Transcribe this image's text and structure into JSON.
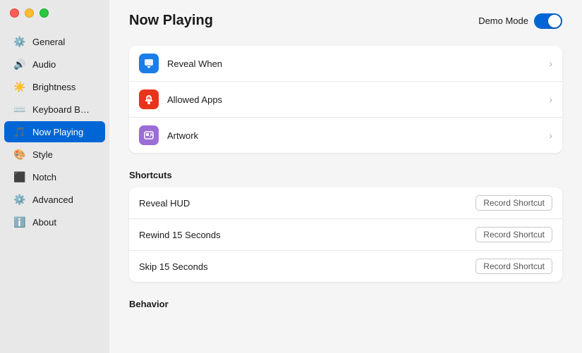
{
  "window": {
    "title": "Now Playing"
  },
  "windowControls": {
    "close": "close",
    "minimize": "minimize",
    "maximize": "maximize"
  },
  "sidebar": {
    "items": [
      {
        "id": "general",
        "label": "General",
        "icon": "⚙️"
      },
      {
        "id": "audio",
        "label": "Audio",
        "icon": "🔊"
      },
      {
        "id": "brightness",
        "label": "Brightness",
        "icon": "☀️"
      },
      {
        "id": "keyboard",
        "label": "Keyboard B…",
        "icon": "⌨️"
      },
      {
        "id": "now-playing",
        "label": "Now Playing",
        "icon": "🎵",
        "active": true
      },
      {
        "id": "style",
        "label": "Style",
        "icon": "🎨"
      },
      {
        "id": "notch",
        "label": "Notch",
        "icon": "⬛"
      },
      {
        "id": "advanced",
        "label": "Advanced",
        "icon": "⚙️"
      },
      {
        "id": "about",
        "label": "About",
        "icon": "ℹ️"
      }
    ]
  },
  "header": {
    "title": "Now Playing",
    "demoModeLabel": "Demo Mode",
    "demoModeOn": true
  },
  "menuRows": [
    {
      "id": "reveal-when",
      "label": "Reveal When",
      "iconBg": "icon-blue",
      "icon": "⬇️"
    },
    {
      "id": "allowed-apps",
      "label": "Allowed Apps",
      "iconBg": "icon-red",
      "icon": "✋"
    },
    {
      "id": "artwork",
      "label": "Artwork",
      "iconBg": "icon-purple",
      "icon": "🖼️"
    }
  ],
  "shortcuts": {
    "sectionTitle": "Shortcuts",
    "items": [
      {
        "id": "reveal-hud",
        "label": "Reveal HUD",
        "btnLabel": "Record Shortcut"
      },
      {
        "id": "rewind-15",
        "label": "Rewind 15 Seconds",
        "btnLabel": "Record Shortcut"
      },
      {
        "id": "skip-15",
        "label": "Skip 15 Seconds",
        "btnLabel": "Record Shortcut"
      }
    ]
  },
  "behavior": {
    "sectionTitle": "Behavior"
  }
}
